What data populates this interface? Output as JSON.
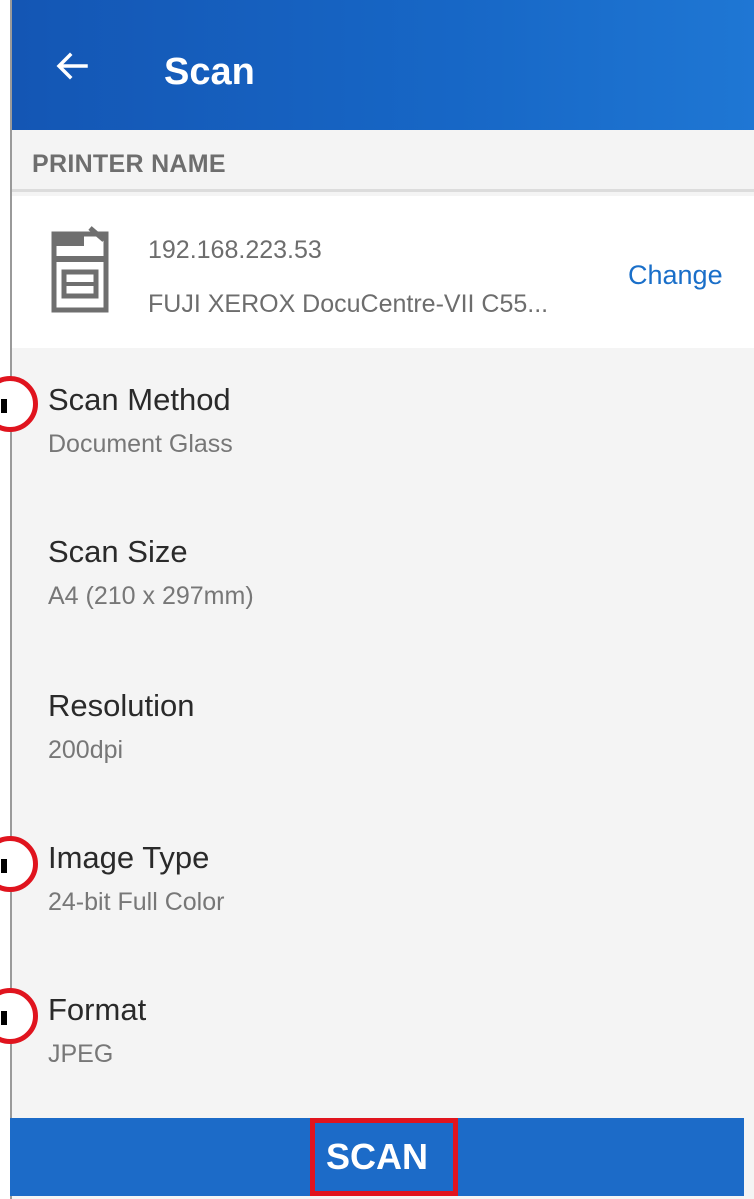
{
  "appbar": {
    "title": "Scan",
    "back_icon": "arrow-left-icon"
  },
  "printer_section": {
    "header": "PRINTER NAME",
    "ip": "192.168.223.53",
    "model": "FUJI XEROX DocuCentre-VII C55...",
    "change_label": "Change",
    "icon": "printer-icon"
  },
  "settings": [
    {
      "label": "Scan Method",
      "value": "Document Glass"
    },
    {
      "label": "Scan Size",
      "value": "A4 (210 x 297mm)"
    },
    {
      "label": "Resolution",
      "value": "200dpi"
    },
    {
      "label": "Image Type",
      "value": "24-bit Full Color"
    },
    {
      "label": "Format",
      "value": "JPEG"
    }
  ],
  "scan_button": {
    "label": "SCAN"
  },
  "colors": {
    "appbar": "#1767c6",
    "accent": "#1a6fc9",
    "button": "#1c6bc8",
    "annotation": "#e0141e"
  }
}
